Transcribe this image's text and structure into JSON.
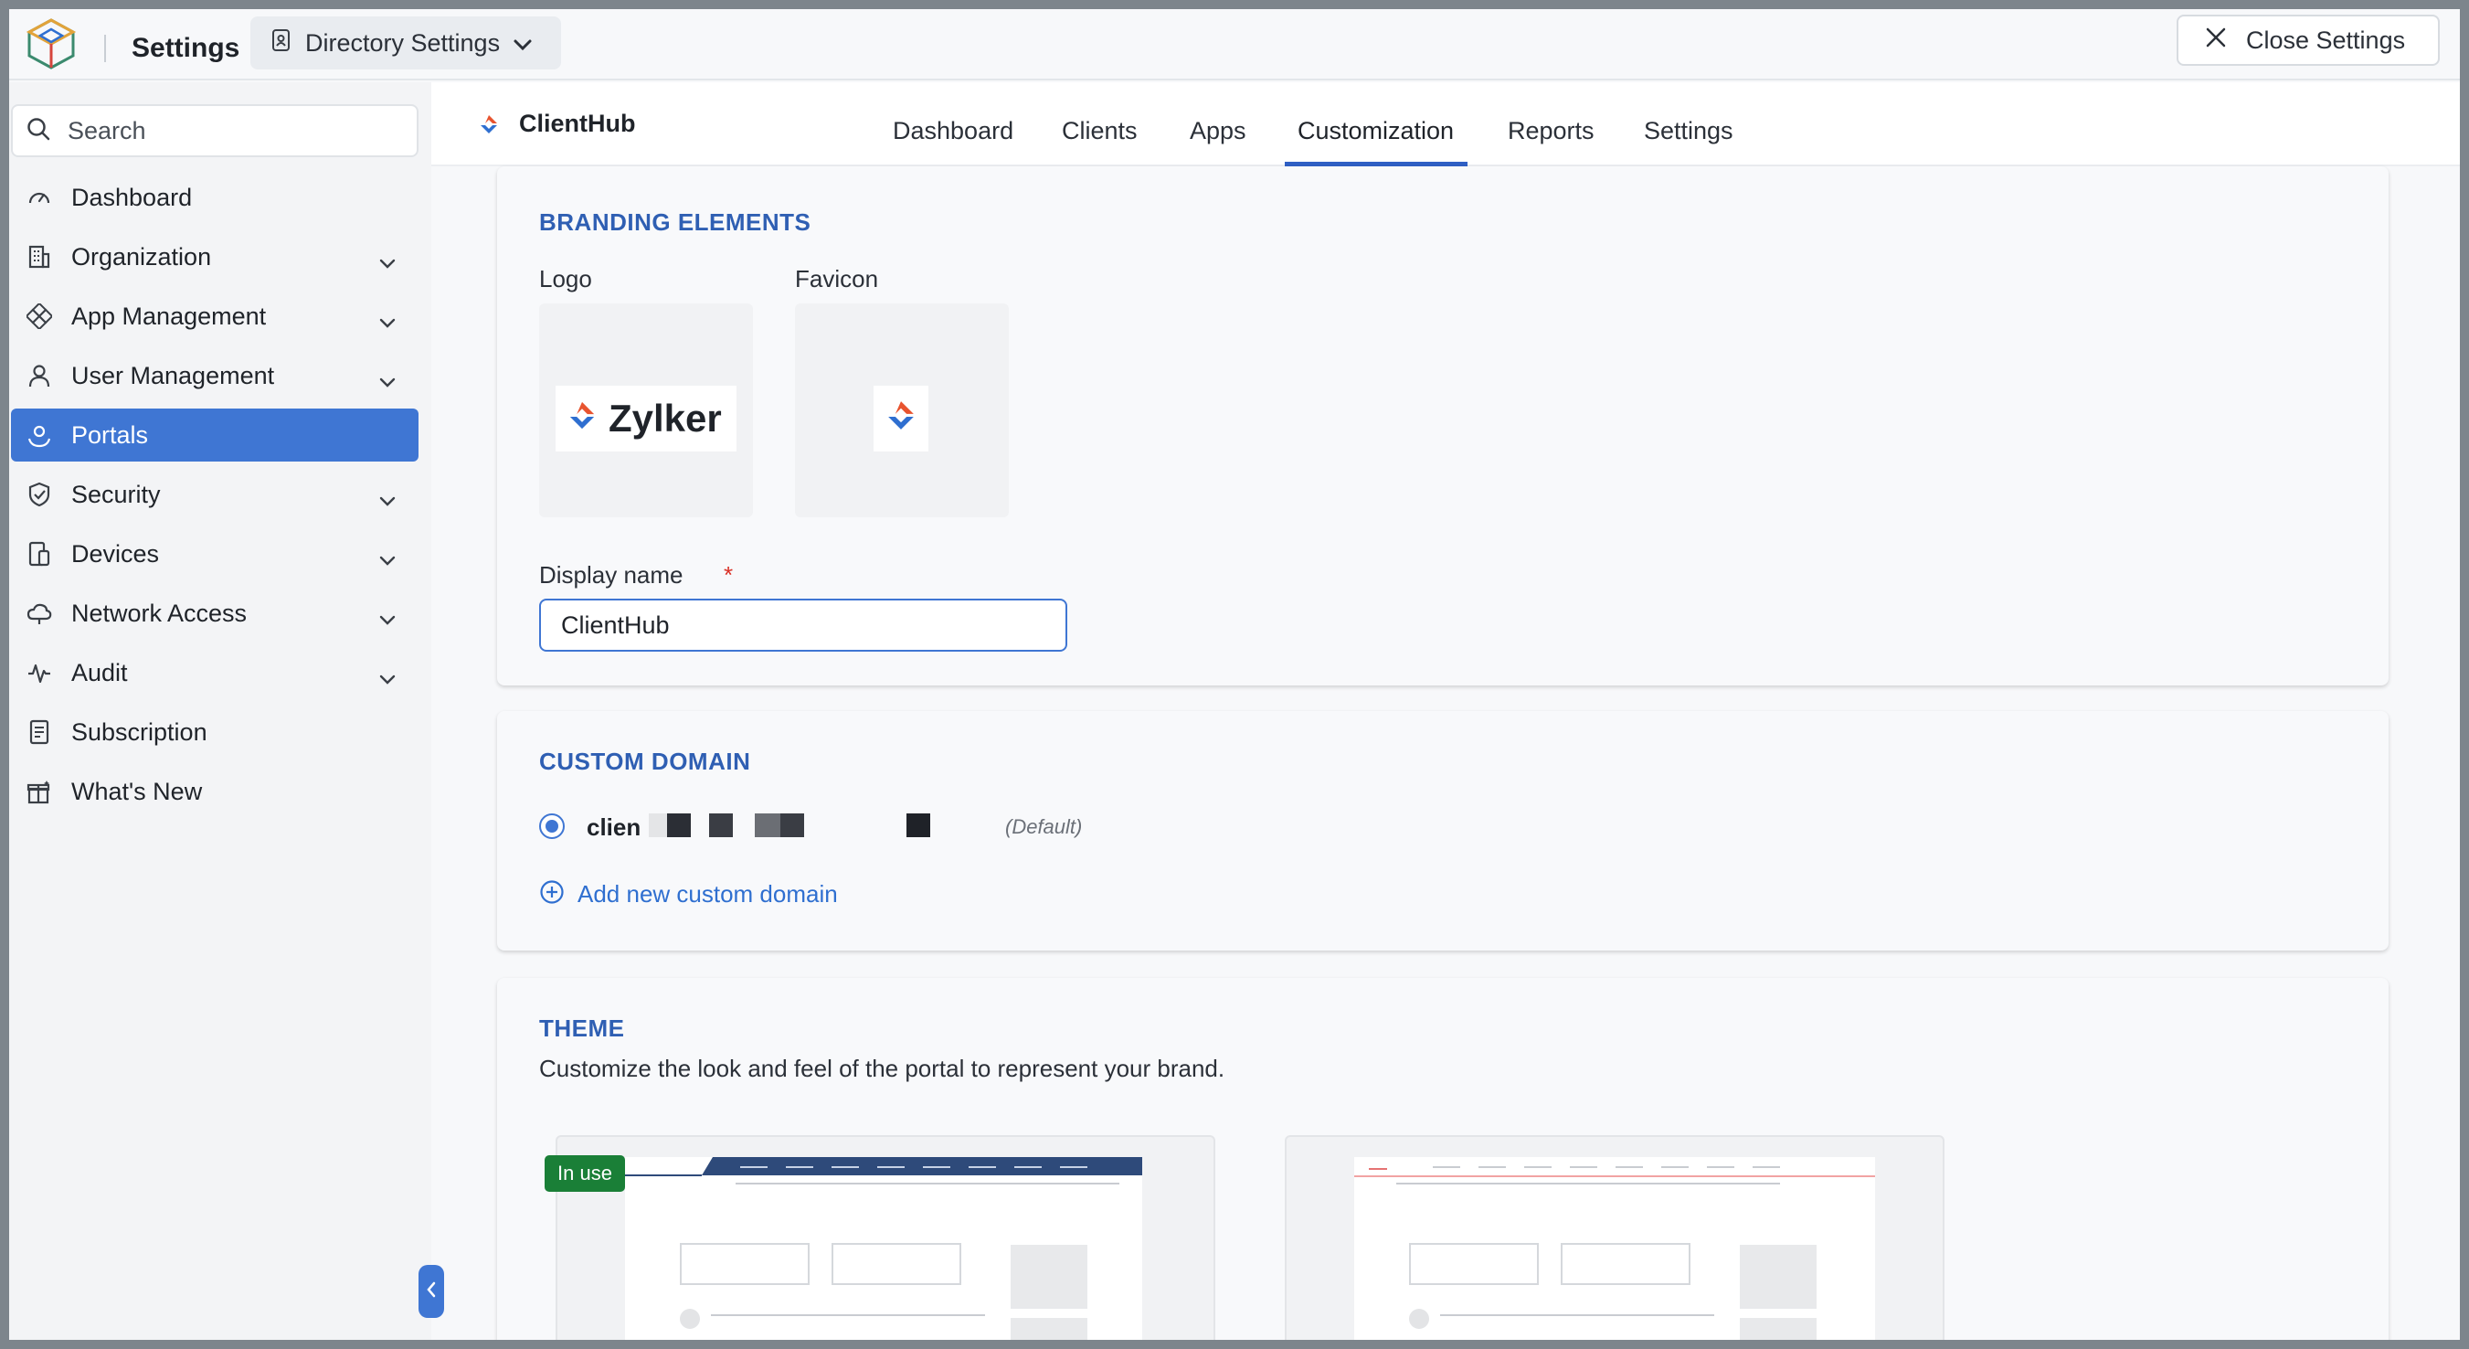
{
  "header": {
    "title": "Settings",
    "directory_dropdown": "Directory Settings",
    "close_button": "Close Settings"
  },
  "sidebar": {
    "search_placeholder": "Search",
    "items": [
      {
        "label": "Dashboard",
        "icon": "gauge-icon",
        "expandable": false,
        "active": false
      },
      {
        "label": "Organization",
        "icon": "building-icon",
        "expandable": true,
        "active": false
      },
      {
        "label": "App Management",
        "icon": "apps-icon",
        "expandable": true,
        "active": false
      },
      {
        "label": "User Management",
        "icon": "user-icon",
        "expandable": true,
        "active": false
      },
      {
        "label": "Portals",
        "icon": "portal-user-icon",
        "expandable": false,
        "active": true
      },
      {
        "label": "Security",
        "icon": "shield-icon",
        "expandable": true,
        "active": false
      },
      {
        "label": "Devices",
        "icon": "devices-icon",
        "expandable": true,
        "active": false
      },
      {
        "label": "Network Access",
        "icon": "cloud-icon",
        "expandable": true,
        "active": false
      },
      {
        "label": "Audit",
        "icon": "pulse-icon",
        "expandable": true,
        "active": false
      },
      {
        "label": "Subscription",
        "icon": "receipt-icon",
        "expandable": false,
        "active": false
      },
      {
        "label": "What's New",
        "icon": "gift-icon",
        "expandable": false,
        "active": false
      }
    ]
  },
  "portal": {
    "name": "ClientHub",
    "tabs": [
      "Dashboard",
      "Clients",
      "Apps",
      "Customization",
      "Reports",
      "Settings"
    ],
    "active_tab": "Customization"
  },
  "branding": {
    "title": "BRANDING ELEMENTS",
    "logo_label": "Logo",
    "logo_text": "Zylker",
    "favicon_label": "Favicon",
    "display_name_label": "Display name",
    "required_mark": "*",
    "display_name_value": "ClientHub"
  },
  "custom_domain": {
    "title": "CUSTOM DOMAIN",
    "domain_prefix": "clien",
    "default_tag": "(Default)",
    "add_link": "Add new custom domain"
  },
  "theme": {
    "title": "THEME",
    "description": "Customize the look and feel of the portal to represent your brand.",
    "in_use_badge": "In use"
  },
  "colors": {
    "accent": "#3f76d3",
    "section_title": "#2f5fb3",
    "in_use_green": "#1a7f37",
    "required_red": "#d93025",
    "theme1_header": "#2e4a7a",
    "theme2_accent": "#e57373"
  }
}
